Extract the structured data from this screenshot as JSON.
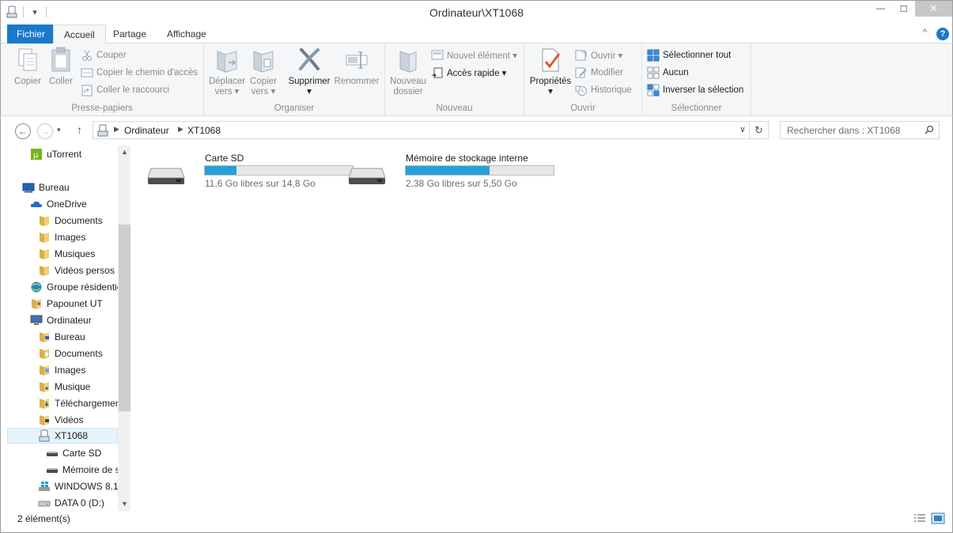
{
  "window": {
    "title": "Ordinateur\\XT1068",
    "minimize": "—",
    "maximize": "☐",
    "close": "✕"
  },
  "qat": {
    "dropdown": "▾"
  },
  "tabs": {
    "file": "Fichier",
    "home": "Accueil",
    "share": "Partage",
    "view": "Affichage",
    "collapse": "^",
    "help": "?"
  },
  "ribbon": {
    "clipboard": {
      "name": "Presse-papiers",
      "copy": "Copier",
      "paste": "Coller",
      "cut": "Couper",
      "copy_path": "Copier le chemin d'accès",
      "paste_shortcut": "Coller le raccourci"
    },
    "organize": {
      "name": "Organiser",
      "move_to": [
        "Déplacer",
        "vers ▾"
      ],
      "copy_to": [
        "Copier",
        "vers ▾"
      ],
      "delete": "Supprimer",
      "delete_arrow": "▾",
      "rename": "Renommer"
    },
    "new": {
      "name": "Nouveau",
      "new_folder": [
        "Nouveau",
        "dossier"
      ],
      "new_item": "Nouvel élément ▾",
      "easy_access": "Accès rapide ▾"
    },
    "open": {
      "name": "Ouvrir",
      "properties": "Propriétés",
      "properties_arrow": "▾",
      "open": "Ouvrir ▾",
      "edit": "Modifier",
      "history": "Historique"
    },
    "select": {
      "name": "Sélectionner",
      "select_all": "Sélectionner tout",
      "select_none": "Aucun",
      "invert": "Inverser la sélection"
    }
  },
  "address": {
    "back": "←",
    "forward": "→",
    "recent": "▾",
    "up": "↑",
    "sep": "▶",
    "crumbs": [
      "Ordinateur",
      "XT1068"
    ],
    "dropdown": "∨",
    "refresh": "↻"
  },
  "search": {
    "placeholder": "Rechercher dans : XT1068"
  },
  "scroll": {
    "up": "▲",
    "down": "▼"
  },
  "nav": [
    {
      "label": "uTorrent",
      "icon": "utorrent-icon"
    },
    {
      "label": "Bureau",
      "icon": "desktop-icon"
    },
    {
      "label": "OneDrive",
      "icon": "onedrive-icon"
    },
    {
      "label": "Documents",
      "icon": "folder-icon"
    },
    {
      "label": "Images",
      "icon": "folder-icon"
    },
    {
      "label": "Musiques",
      "icon": "folder-icon"
    },
    {
      "label": "Vidéos persos",
      "icon": "folder-icon"
    },
    {
      "label": "Groupe résidentiel",
      "icon": "homegroup-icon"
    },
    {
      "label": "Papounet UT",
      "icon": "user-folder-icon"
    },
    {
      "label": "Ordinateur",
      "icon": "computer-icon"
    },
    {
      "label": "Bureau",
      "icon": "desktop-folder-icon"
    },
    {
      "label": "Documents",
      "icon": "documents-folder-icon"
    },
    {
      "label": "Images",
      "icon": "pictures-folder-icon"
    },
    {
      "label": "Musique",
      "icon": "music-folder-icon"
    },
    {
      "label": "Téléchargements",
      "icon": "downloads-folder-icon"
    },
    {
      "label": "Vidéos",
      "icon": "videos-folder-icon"
    },
    {
      "label": "XT1068",
      "icon": "phone-icon"
    },
    {
      "label": "Carte SD",
      "icon": "drive-icon"
    },
    {
      "label": "Mémoire de stockage interne",
      "icon": "drive-icon"
    },
    {
      "label": "WINDOWS 8.1",
      "icon": "windows-drive-icon"
    },
    {
      "label": "DATA 0 (D:)",
      "icon": "drive-icon"
    }
  ],
  "drives": [
    {
      "name": "Carte SD",
      "free": "11,6 Go libres sur 14,8 Go",
      "used_fraction": 0.216
    },
    {
      "name": "Mémoire de stockage interne",
      "free": "2,38 Go libres sur 5,50 Go",
      "used_fraction": 0.567
    }
  ],
  "status": {
    "count": "2 élément(s)"
  },
  "colors": {
    "accent": "#1979ca",
    "bar_fill": "#26a0da",
    "selection": "#e5f3fb"
  }
}
